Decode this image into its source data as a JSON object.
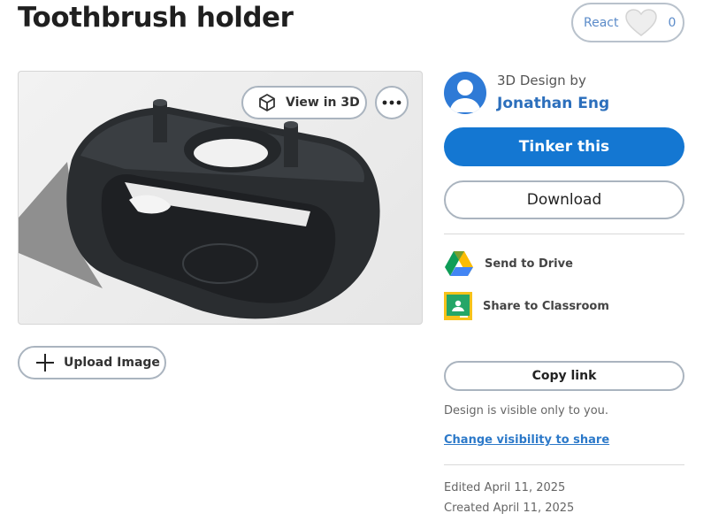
{
  "page": {
    "title": "Toothbrush holder"
  },
  "react": {
    "label": "React",
    "count": "0"
  },
  "viewer": {
    "view3d_label": "View in 3D"
  },
  "upload": {
    "label": "Upload Image"
  },
  "author": {
    "by_label": "3D Design by",
    "name": "Jonathan Eng"
  },
  "actions": {
    "tinker_label": "Tinker this",
    "download_label": "Download",
    "send_drive_label": "Send to Drive",
    "share_classroom_label": "Share to Classroom",
    "copy_link_label": "Copy link"
  },
  "visibility": {
    "text": "Design is visible only to you.",
    "change_link": "Change visibility to share"
  },
  "dates": {
    "edited": "Edited April 11, 2025",
    "created": "Created April 11, 2025"
  },
  "colors": {
    "primary": "#1477d2",
    "link": "#2c79c9",
    "model": "#2a2d30"
  },
  "icons": {
    "react": "heart-icon",
    "view3d": "cube-icon",
    "more": "more-dots-icon",
    "upload": "plus-icon",
    "drive": "google-drive-icon",
    "classroom": "google-classroom-icon"
  }
}
